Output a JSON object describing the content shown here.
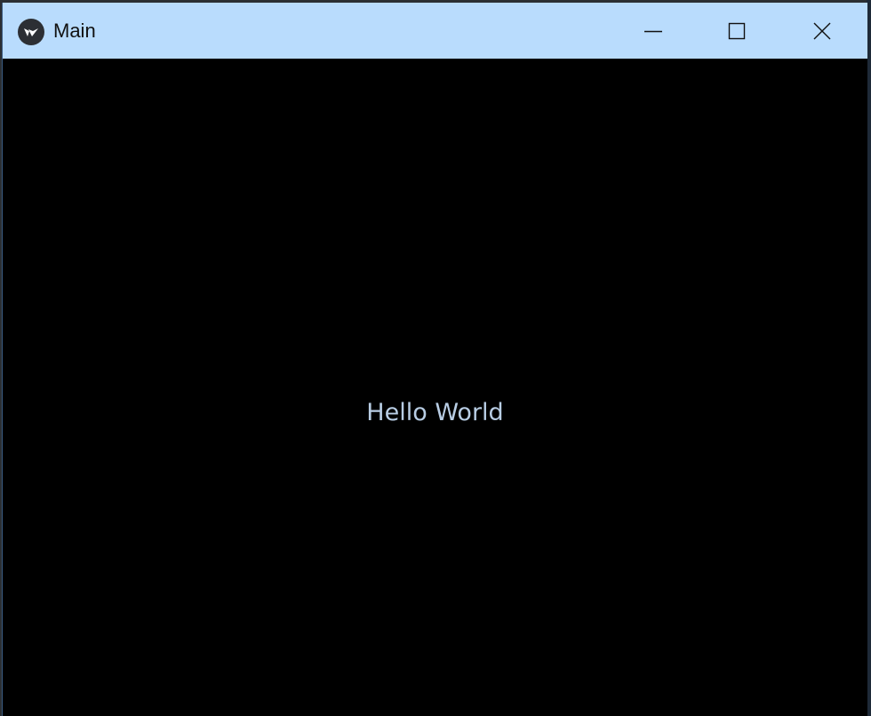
{
  "window": {
    "title": "Main",
    "icon": "kivy-logo-icon",
    "controls": {
      "minimize_icon": "minimize-icon",
      "maximize_icon": "maximize-icon",
      "close_icon": "close-icon"
    }
  },
  "content": {
    "label": "Hello World"
  },
  "colors": {
    "titlebar": "#b9dcfd",
    "background": "#000000",
    "label": "#b8cde4"
  }
}
